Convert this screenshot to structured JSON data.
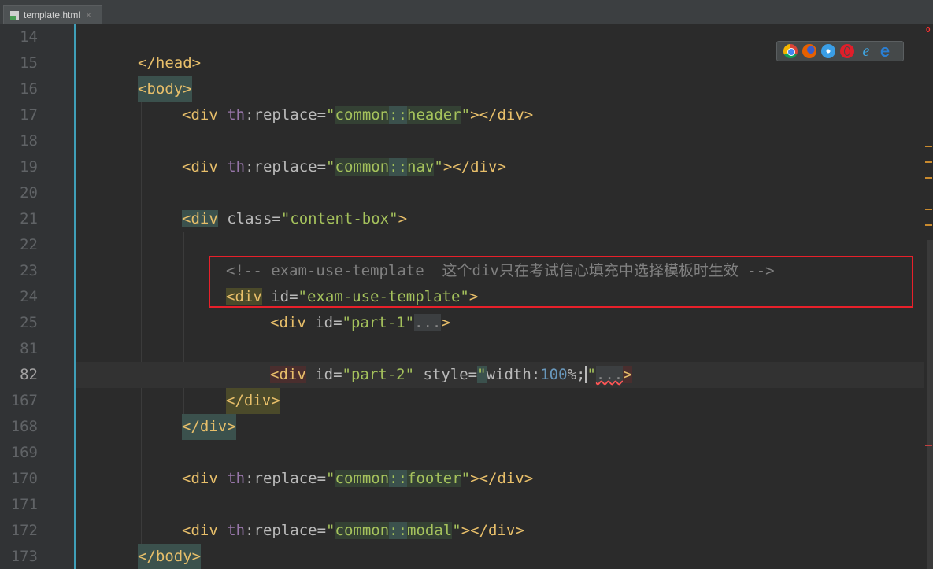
{
  "tab": {
    "label": "template.html",
    "close": "×"
  },
  "gutter": {
    "lines": [
      "14",
      "15",
      "16",
      "17",
      "18",
      "19",
      "20",
      "21",
      "22",
      "23",
      "24",
      "25",
      "81",
      "82",
      "167",
      "168",
      "169",
      "170",
      "171",
      "172",
      "173"
    ]
  },
  "browsers": [
    "chrome-icon",
    "firefox-icon",
    "safari-icon",
    "opera-icon",
    "ie-icon",
    "edge-icon"
  ],
  "status": {
    "marker_label": "0"
  },
  "code": {
    "l15": {
      "text": "</head>"
    },
    "l16": {
      "text": "<body>"
    },
    "l17": {
      "open": "<div ",
      "ns": "th",
      "attr": ":replace=",
      "q1": "\"",
      "ref1": "common",
      "sep": "::",
      "ref2": "header",
      "q2": "\"",
      "close": "></div>"
    },
    "l19": {
      "open": "<div ",
      "ns": "th",
      "attr": ":replace=",
      "q1": "\"",
      "ref1": "common",
      "sep": "::",
      "ref2": "nav",
      "q2": "\"",
      "close": "></div>"
    },
    "l21": {
      "tag": "<div",
      "attr": " class=",
      "val": "\"content-box\"",
      "close": ">"
    },
    "l23": {
      "comment": "<!-- exam-use-template  这个div只在考试信心填充中选择模板时生效 -->"
    },
    "l24": {
      "tag": "<div",
      "attr": " id=",
      "val": "\"exam-use-template\"",
      "close": ">"
    },
    "l25": {
      "tag": "<div",
      "attr": " id=",
      "val": "\"part-1\"",
      "dots": "...",
      "close": ">"
    },
    "l82": {
      "tag": "<div",
      "attr": " id=",
      "val": "\"part-2\"",
      "attr2": " style=",
      "q1": "\"",
      "prop": "width:",
      "num": "100",
      "pct": "%;",
      "q2": "\"",
      "dots": "...",
      "close": ">"
    },
    "l167": {
      "text": "</div>"
    },
    "l168": {
      "text": "</div>"
    },
    "l170": {
      "open": "<div ",
      "ns": "th",
      "attr": ":replace=",
      "q1": "\"",
      "ref1": "common",
      "sep": "::",
      "ref2": "footer",
      "q2": "\"",
      "close": "></div>"
    },
    "l172": {
      "open": "<div ",
      "ns": "th",
      "attr": ":replace=",
      "q1": "\"",
      "ref1": "common",
      "sep": "::",
      "ref2": "modal",
      "q2": "\"",
      "close": "></div>"
    },
    "l173": {
      "text": "</body>"
    }
  },
  "colors": {
    "background": "#2b2b2b",
    "gutter": "#313335",
    "tag": "#e8bf6a",
    "string": "#6a8759",
    "comment": "#808080",
    "namespace": "#9876aa",
    "number": "#6897bb",
    "highlight_box": "#e8202a"
  }
}
